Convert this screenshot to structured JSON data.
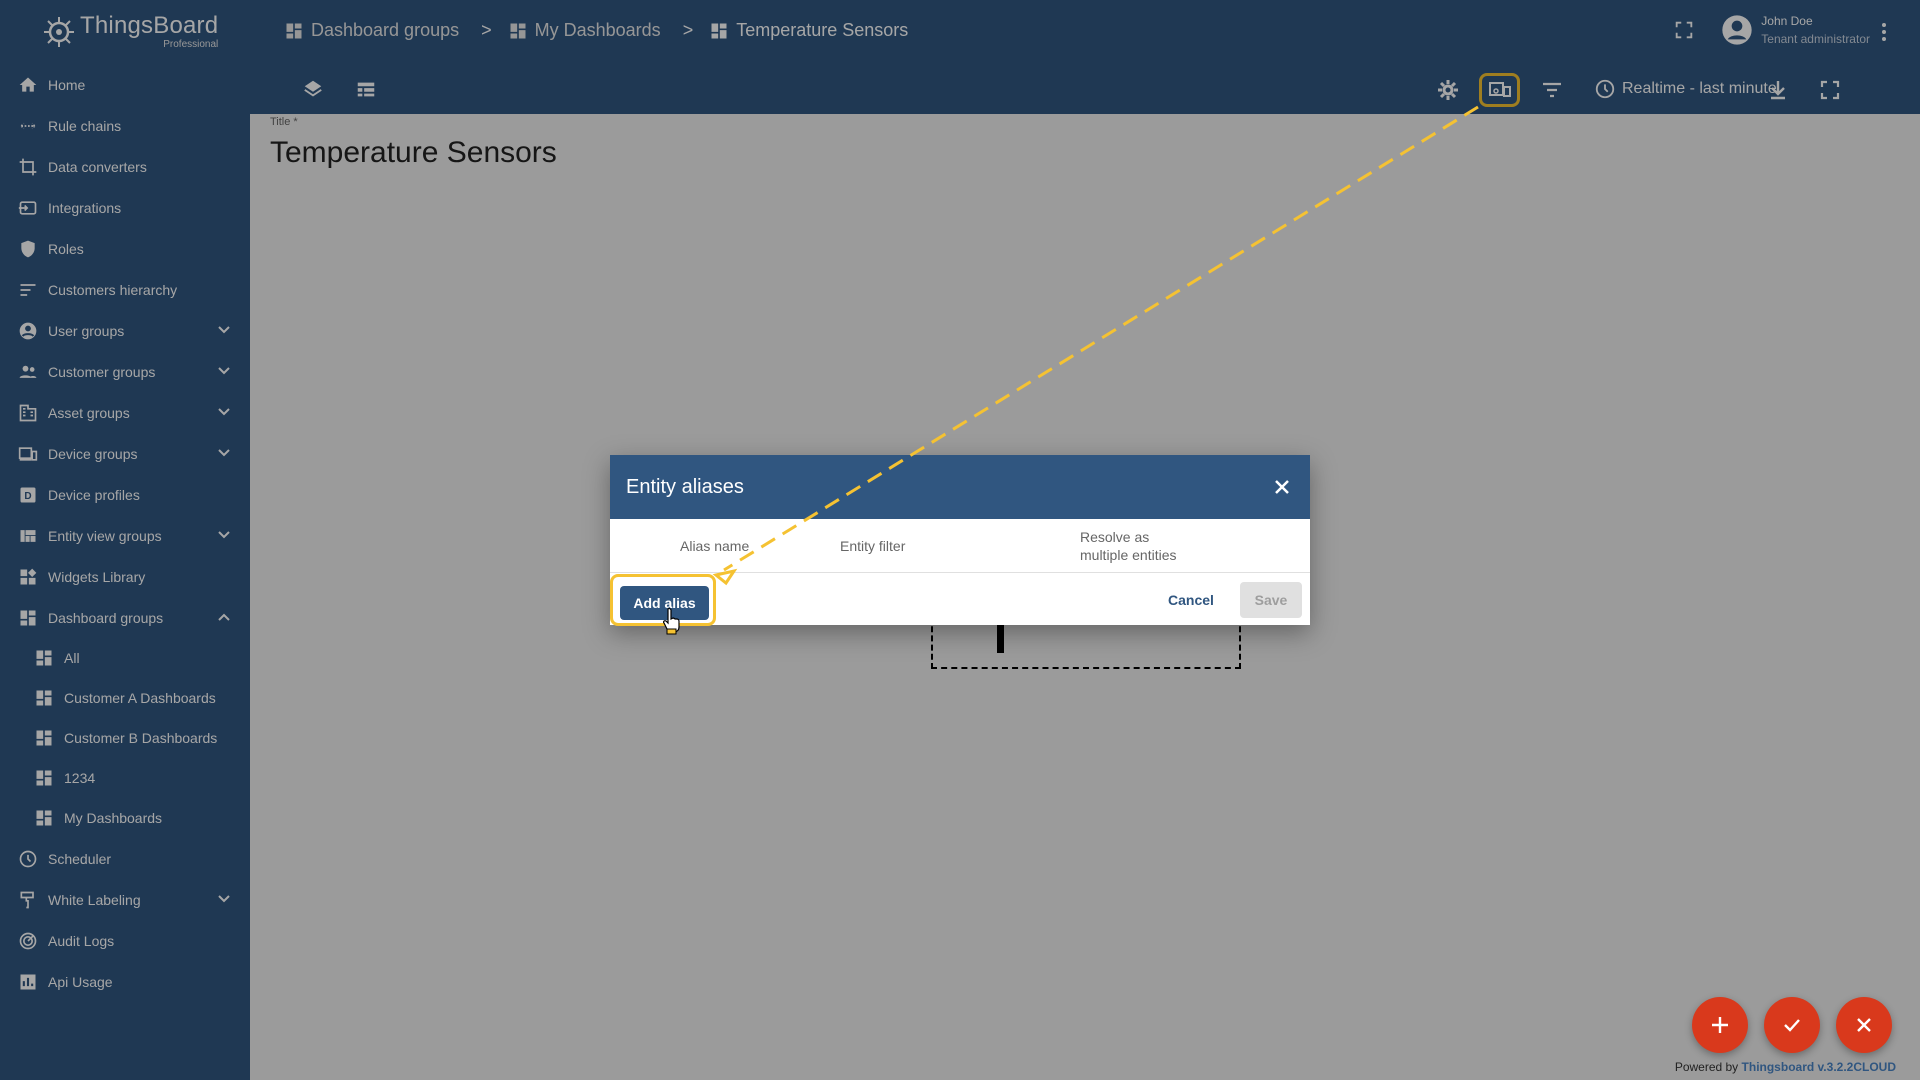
{
  "brand": {
    "name": "ThingsBoard",
    "edition": "Professional"
  },
  "colors": {
    "primary": "#305680",
    "accent": "#f5c232",
    "fab": "#d9391c"
  },
  "sidebar": {
    "items": [
      {
        "label": "Home",
        "icon": "home-icon"
      },
      {
        "label": "Rule chains",
        "icon": "rule-chain-icon"
      },
      {
        "label": "Data converters",
        "icon": "converter-icon"
      },
      {
        "label": "Integrations",
        "icon": "integration-icon"
      },
      {
        "label": "Roles",
        "icon": "shield-icon"
      },
      {
        "label": "Customers hierarchy",
        "icon": "hierarchy-icon"
      },
      {
        "label": "User groups",
        "icon": "user-icon",
        "expandable": true
      },
      {
        "label": "Customer groups",
        "icon": "people-icon",
        "expandable": true
      },
      {
        "label": "Asset groups",
        "icon": "domain-icon",
        "expandable": true
      },
      {
        "label": "Device groups",
        "icon": "devices-icon",
        "expandable": true
      },
      {
        "label": "Device profiles",
        "icon": "device-profile-icon"
      },
      {
        "label": "Entity view groups",
        "icon": "view-quilt-icon",
        "expandable": true
      },
      {
        "label": "Widgets Library",
        "icon": "widgets-icon"
      },
      {
        "label": "Dashboard groups",
        "icon": "dashboard-icon",
        "expanded": true
      }
    ],
    "subitems": [
      {
        "label": "All"
      },
      {
        "label": "Customer A Dashboards"
      },
      {
        "label": "Customer B Dashboards"
      },
      {
        "label": "1234"
      },
      {
        "label": "My Dashboards"
      }
    ],
    "bottom_items": [
      {
        "label": "Scheduler",
        "icon": "clock-icon"
      },
      {
        "label": "White Labeling",
        "icon": "brush-icon",
        "expandable": true
      },
      {
        "label": "Audit Logs",
        "icon": "track-changes-icon"
      },
      {
        "label": "Api Usage",
        "icon": "insert-chart-icon"
      }
    ]
  },
  "breadcrumb": {
    "items": [
      "Dashboard groups",
      "My Dashboards",
      "Temperature Sensors"
    ],
    "separator": ">"
  },
  "user": {
    "name": "John Doe",
    "role": "Tenant administrator"
  },
  "toolbar": {
    "timewindow": "Realtime - last minute"
  },
  "dashboard": {
    "title_label": "Title *",
    "title": "Temperature Sensors"
  },
  "dialog": {
    "title": "Entity aliases",
    "columns": {
      "alias_name": "Alias name",
      "entity_filter": "Entity filter",
      "resolve_line1": "Resolve as",
      "resolve_line2": "multiple entities"
    },
    "add_label": "Add alias",
    "cancel_label": "Cancel",
    "save_label": "Save"
  },
  "footer": {
    "prefix": "Powered by",
    "link": "Thingsboard v.3.2.2CLOUD"
  }
}
